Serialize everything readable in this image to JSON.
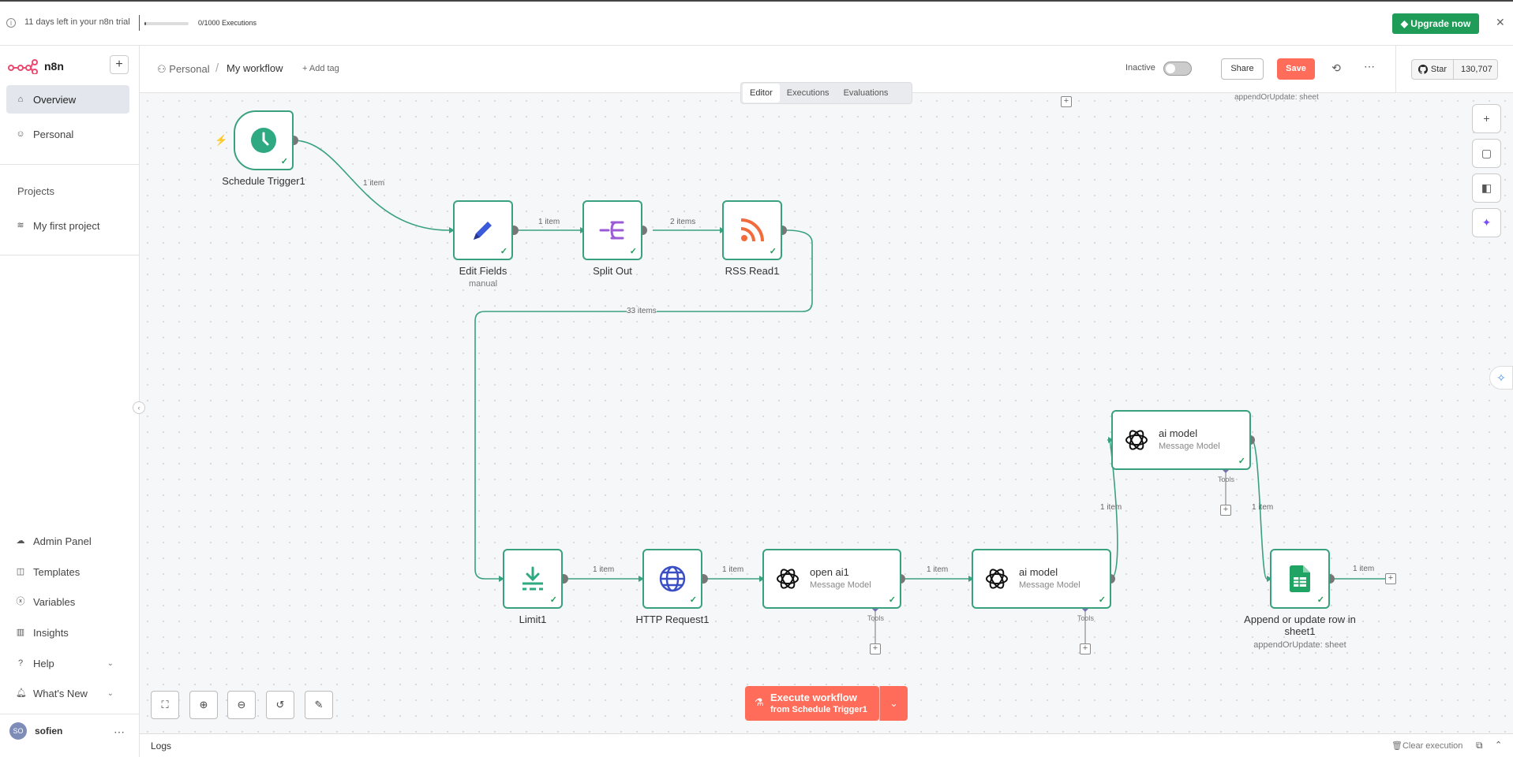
{
  "banner": {
    "trial_text": "11 days left in your n8n trial",
    "executions_text": "0/1000 Executions",
    "executions_progress": 0.0,
    "upgrade_label": "Upgrade now",
    "close_icon": "close-icon"
  },
  "sidebar": {
    "app_name": "n8n",
    "items": [
      {
        "label": "Overview",
        "icon": "home-icon",
        "active": true
      },
      {
        "label": "Personal",
        "icon": "user-icon",
        "active": false
      }
    ],
    "projects_title": "Projects",
    "projects": [
      {
        "label": "My first project",
        "icon": "layers-icon"
      }
    ],
    "bottom_items": [
      {
        "label": "Admin Panel",
        "icon": "cloud-icon"
      },
      {
        "label": "Templates",
        "icon": "box-icon"
      },
      {
        "label": "Variables",
        "icon": "variable-icon"
      },
      {
        "label": "Insights",
        "icon": "chart-icon"
      },
      {
        "label": "Help",
        "icon": "help-icon"
      },
      {
        "label": "What's New",
        "icon": "bell-icon"
      }
    ],
    "user": {
      "initials": "SO",
      "name": "sofien"
    }
  },
  "header": {
    "breadcrumb_project": "Personal",
    "breadcrumb_sep": "/",
    "workflow_name": "My workflow",
    "add_tag": "+ Add tag",
    "status_label": "Inactive",
    "share_label": "Share",
    "save_label": "Save",
    "github_star_label": "Star",
    "github_count": "130,707"
  },
  "tabs": [
    "Editor",
    "Executions",
    "Evaluations"
  ],
  "nodes": {
    "schedule": {
      "label": "Schedule Trigger1"
    },
    "edit_fields": {
      "label": "Edit Fields",
      "sub": "manual"
    },
    "split_out": {
      "label": "Split Out"
    },
    "rss": {
      "label": "RSS Read1"
    },
    "limit": {
      "label": "Limit1"
    },
    "http": {
      "label": "HTTP Request1"
    },
    "openai": {
      "title": "open ai1",
      "sub": "Message Model"
    },
    "ai1": {
      "title": "ai model",
      "sub": "Message Model"
    },
    "ai2": {
      "title": "ai model",
      "sub": "Message Model"
    },
    "sheets": {
      "label": "Append or update row in sheet1",
      "sub": "appendOrUpdate: sheet"
    }
  },
  "edges": {
    "e1": "1 item",
    "e2": "1 item",
    "e3": "2 items",
    "e4": "33 items",
    "e5": "1 item",
    "e6": "1 item",
    "e7": "1 item",
    "e8": "1 item",
    "e9": "1 item",
    "e10": "1 item"
  },
  "tools_label": "Tools",
  "ghost_sub": "appendOrUpdate: sheet",
  "execute": {
    "line1": "Execute workflow",
    "line2": "from Schedule Trigger1"
  },
  "logs": {
    "title": "Logs",
    "clear": "Clear execution"
  },
  "colors": {
    "accent": "#ff6d5a",
    "success": "#3aa17e",
    "upgrade": "#1f9c58"
  }
}
